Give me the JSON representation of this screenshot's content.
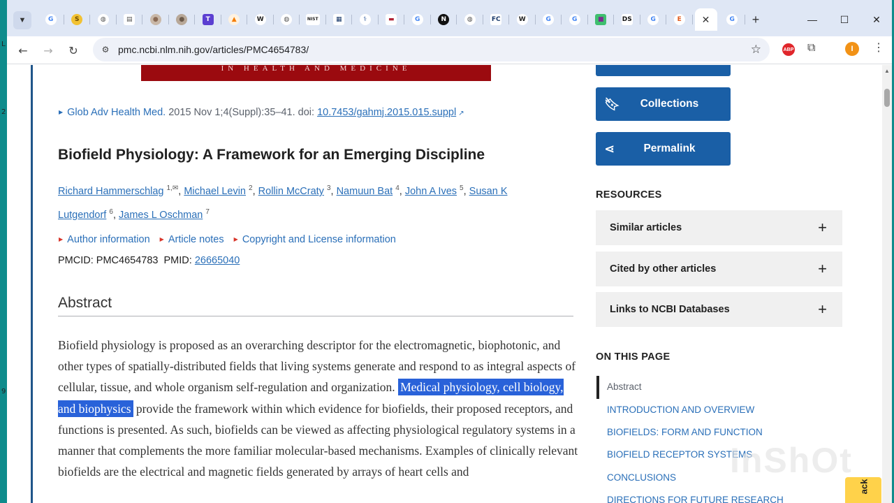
{
  "strip_marks": [
    "L",
    "2",
    "9"
  ],
  "tabs": [
    {
      "icon": "google-icon",
      "glyph": "G",
      "color": "#4285f4",
      "bg": "#ffffff"
    },
    {
      "icon": "s-coin-icon",
      "glyph": "S",
      "color": "#6b4a00",
      "bg": "#f2c233"
    },
    {
      "icon": "globe-icon",
      "glyph": "◍",
      "color": "#555555",
      "bg": "#ffffff"
    },
    {
      "icon": "document-icon",
      "glyph": "▤",
      "color": "#555555",
      "bg": "#ffffff"
    },
    {
      "icon": "avatar-icon",
      "glyph": "●",
      "color": "#8a6a55",
      "bg": "#c9b8a8"
    },
    {
      "icon": "avatar-icon-2",
      "glyph": "●",
      "color": "#6c5a4a",
      "bg": "#b8a898"
    },
    {
      "icon": "t-icon",
      "glyph": "T",
      "color": "#ffffff",
      "bg": "#5b3fd1"
    },
    {
      "icon": "flame-icon",
      "glyph": "▲",
      "color": "#f57c00",
      "bg": "#fff2e0"
    },
    {
      "icon": "wikipedia-icon",
      "glyph": "W",
      "color": "#222222",
      "bg": "#ffffff"
    },
    {
      "icon": "globe-icon-2",
      "glyph": "◍",
      "color": "#555555",
      "bg": "#ffffff"
    },
    {
      "icon": "nist-icon",
      "glyph": "NIST",
      "color": "#222222",
      "bg": "#ffffff"
    },
    {
      "icon": "ieee-icon",
      "glyph": "▦",
      "color": "#1a3a6b",
      "bg": "#ffffff"
    },
    {
      "icon": "caduceus-icon",
      "glyph": "⚕",
      "color": "#2a5599",
      "bg": "#ffffff"
    },
    {
      "icon": "us-flag-icon",
      "glyph": "▬",
      "color": "#b22234",
      "bg": "#ffffff"
    },
    {
      "icon": "google-icon-2",
      "glyph": "G",
      "color": "#4285f4",
      "bg": "#ffffff"
    },
    {
      "icon": "n-circle-icon",
      "glyph": "N",
      "color": "#ffffff",
      "bg": "#111111"
    },
    {
      "icon": "globe-icon-3",
      "glyph": "◍",
      "color": "#555555",
      "bg": "#ffffff"
    },
    {
      "icon": "fc-icon",
      "glyph": "FC",
      "color": "#1a3a6b",
      "bg": "#ffffff"
    },
    {
      "icon": "wikipedia-icon-2",
      "glyph": "W",
      "color": "#222222",
      "bg": "#ffffff"
    },
    {
      "icon": "google-icon-3",
      "glyph": "G",
      "color": "#4285f4",
      "bg": "#ffffff"
    },
    {
      "icon": "google-icon-4",
      "glyph": "G",
      "color": "#4285f4",
      "bg": "#ffffff"
    },
    {
      "icon": "colorblocks-icon",
      "glyph": "■",
      "color": "#7b2d8e",
      "bg": "#3fbf6f"
    },
    {
      "icon": "ds-icon",
      "glyph": "DS",
      "color": "#111111",
      "bg": "#ffffff"
    },
    {
      "icon": "google-icon-5",
      "glyph": "G",
      "color": "#4285f4",
      "bg": "#ffffff"
    },
    {
      "icon": "e-icon",
      "glyph": "E",
      "color": "#e25a1c",
      "bg": "#ffffff"
    }
  ],
  "active_tab_close": "✕",
  "after_active_tab": {
    "icon": "google-icon-6",
    "glyph": "G",
    "color": "#4285f4"
  },
  "window_controls": {
    "minimize": "—",
    "maximize": "☐",
    "close": "✕"
  },
  "toolbar": {
    "url": "pmc.ncbi.nlm.nih.gov/articles/PMC4654783/",
    "profile_initial": "I",
    "abp_label": "ABP"
  },
  "article": {
    "banner_text": "IN HEALTH AND MEDICINE",
    "citation_journal": "Glob Adv Health Med.",
    "citation_details": " 2015 Nov 1;4(Suppl):35–41. doi: ",
    "citation_doi": "10.7453/gahmj.2015.015.suppl",
    "title": "Biofield Physiology: A Framework for an Emerging Discipline",
    "authors": [
      {
        "name": "Richard Hammerschlag",
        "sup": "1,"
      },
      {
        "name": "Michael Levin",
        "sup": "2"
      },
      {
        "name": "Rollin McCraty",
        "sup": "3"
      },
      {
        "name": "Namuun Bat",
        "sup": "4"
      },
      {
        "name": "John A Ives",
        "sup": "5"
      },
      {
        "name": "Susan K Lutgendorf",
        "sup": "6"
      },
      {
        "name": "James L Oschman",
        "sup": "7"
      }
    ],
    "meta_links": [
      "Author information",
      "Article notes",
      "Copyright and License information"
    ],
    "pmcid_label": "PMCID: PMC4654783",
    "pmid_label": "PMID: ",
    "pmid": "26665040",
    "abstract_heading": "Abstract",
    "abstract_before": "Biofield physiology is proposed as an overarching descriptor for the electromagnetic, biophotonic, and other types of spatially-distributed fields that living systems generate and respond to as integral aspects of cellular, tissue, and whole organism self-regulation and organization.",
    "abstract_highlight": "Medical physiology, cell biology, and biophysics",
    "abstract_after": " provide the framework within which evidence for biofields, their proposed receptors, and functions is presented. As such, biofields can be viewed as affecting physiological regulatory systems in a manner that complements the more familiar molecular-based mechanisms. Examples of clinically relevant biofields are the electrical and magnetic fields generated by arrays of heart cells and"
  },
  "sidebar": {
    "buttons": [
      {
        "label": "Collections",
        "icon": "bookmark-icon"
      },
      {
        "label": "Permalink",
        "icon": "share-icon"
      }
    ],
    "resources_heading": "RESOURCES",
    "resources": [
      "Similar articles",
      "Cited by other articles",
      "Links to NCBI Databases"
    ],
    "on_this_page_heading": "ON THIS PAGE",
    "on_this_page": [
      "Abstract",
      "INTRODUCTION AND OVERVIEW",
      "BIOFIELDS: FORM AND FUNCTION",
      "BIOFIELD RECEPTOR SYSTEMS",
      "CONCLUSIONS",
      "DIRECTIONS FOR FUTURE RESEARCH"
    ],
    "back_tab": "ack"
  },
  "watermark": "InShOt",
  "colors": {
    "accent_button": "#1a5fa6",
    "link": "#2a6fb8",
    "highlight": "#2962d9",
    "banner": "#9b0a0f"
  }
}
